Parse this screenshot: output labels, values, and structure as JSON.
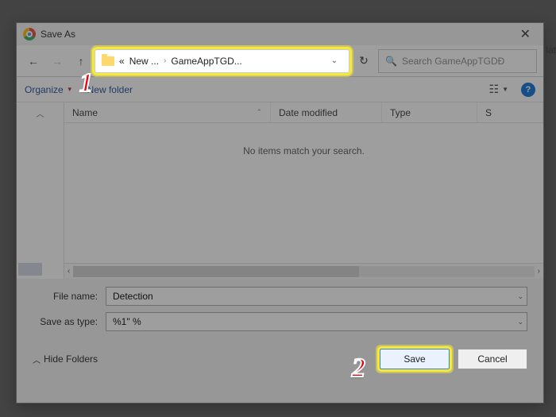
{
  "window": {
    "title": "Save As"
  },
  "breadcrumb": {
    "prefix": "«",
    "part1": "New ...",
    "part2": "GameAppTGD..."
  },
  "search": {
    "placeholder": "Search GameAppTGDĐ"
  },
  "toolbar": {
    "organize": "Organize",
    "newfolder": "New folder"
  },
  "columns": {
    "name": "Name",
    "date": "Date modified",
    "type": "Type",
    "size": "S"
  },
  "list": {
    "empty": "No items match your search."
  },
  "fields": {
    "filename_label": "File name:",
    "filename_value": "Detection",
    "savetype_label": "Save as type:",
    "savetype_value": "%1\" %"
  },
  "footer": {
    "hide_folders": "Hide Folders",
    "save": "Save",
    "cancel": "Cancel"
  },
  "annotations": {
    "a1": "1",
    "a2": "2"
  },
  "edge_text": "lat"
}
